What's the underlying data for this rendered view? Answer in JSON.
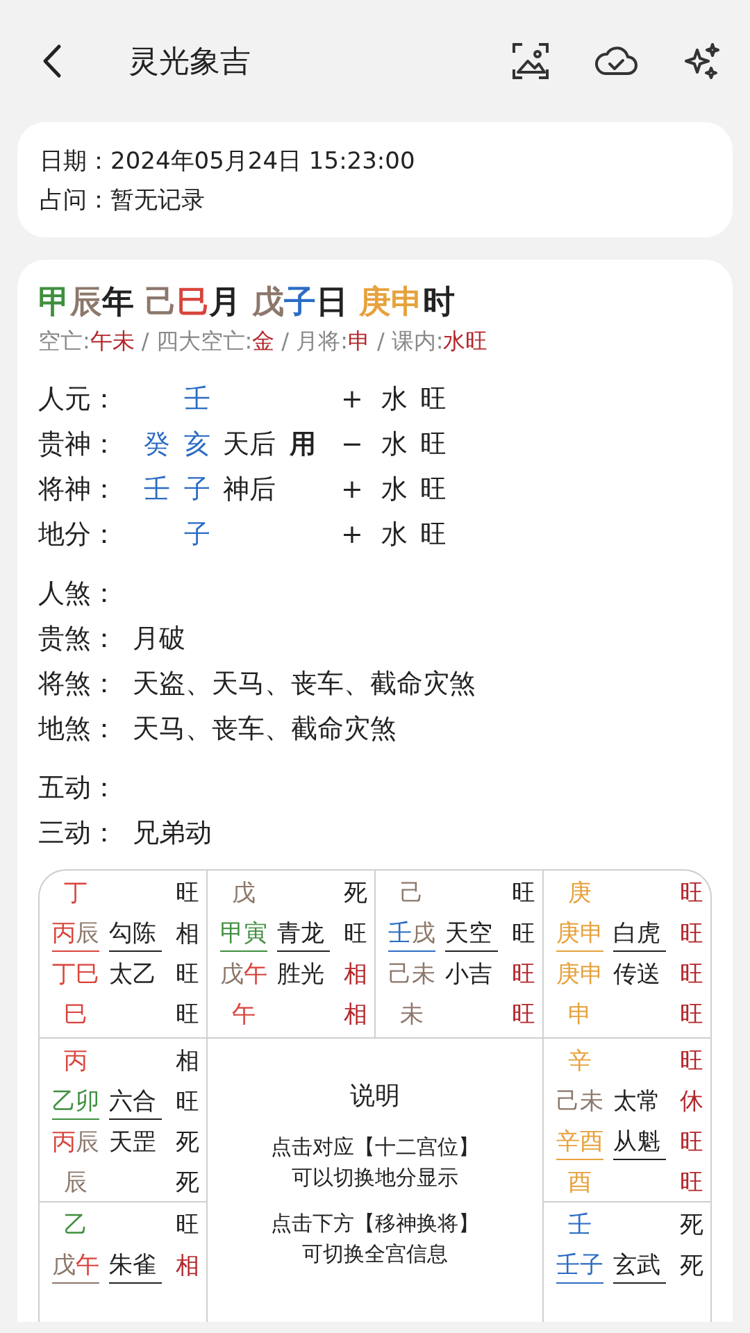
{
  "header": {
    "title": "灵光象吉"
  },
  "info": [
    {
      "label": "日期：",
      "value": "2024年05月24日 15:23:00"
    },
    {
      "label": "占问：",
      "value": "暂无记录"
    }
  ],
  "pillars": [
    {
      "chars": [
        {
          "t": "甲",
          "color": "#3f8f3f"
        },
        {
          "t": "辰",
          "color": "#8c776b"
        }
      ],
      "suffix": "年"
    },
    {
      "chars": [
        {
          "t": "己",
          "color": "#8c776b"
        },
        {
          "t": "巳",
          "color": "#d9443c"
        }
      ],
      "suffix": "月"
    },
    {
      "chars": [
        {
          "t": "戊",
          "color": "#8c776b"
        },
        {
          "t": "子",
          "color": "#2b6cc4"
        }
      ],
      "suffix": "日"
    },
    {
      "chars": [
        {
          "t": "庚",
          "color": "#e6a23c"
        },
        {
          "t": "申",
          "color": "#e6a23c"
        }
      ],
      "suffix": "时"
    }
  ],
  "kong_line": {
    "separator": "/",
    "items": [
      {
        "label": "空亡:",
        "value": "午未"
      },
      {
        "label": "四大空亡:",
        "value": "金"
      },
      {
        "label": "月将:",
        "value": "申"
      },
      {
        "label": "课内:",
        "value": "水旺"
      }
    ]
  },
  "positions": [
    {
      "label": "人元：",
      "char_2": "壬",
      "sign": "+",
      "element": "水",
      "state": "旺"
    },
    {
      "label": "贵神：",
      "char_1": "癸",
      "char_2": "亥",
      "god": "天后",
      "use": "用",
      "sign": "−",
      "element": "水",
      "state": "旺"
    },
    {
      "label": "将神：",
      "char_1": "壬",
      "char_2": "子",
      "god": "神后",
      "sign": "+",
      "element": "水",
      "state": "旺"
    },
    {
      "label": "地分：",
      "char_2": "子",
      "sign": "+",
      "element": "水",
      "state": "旺"
    }
  ],
  "shas": [
    {
      "label": "人煞："
    },
    {
      "label": "贵煞：",
      "value": "月破"
    },
    {
      "label": "将煞：",
      "value": "天盗、天马、丧车、截命灾煞"
    },
    {
      "label": "地煞：",
      "value": "天马、丧车、截命灾煞"
    }
  ],
  "dongs": [
    {
      "label": "五动："
    },
    {
      "label": "三动：",
      "value": "兄弟动"
    }
  ],
  "grid": {
    "top_row": [
      {
        "lines": [
          {
            "chars": [
              {
                "t": "丁",
                "color": "#d9443c"
              }
            ],
            "status": {
              "t": "旺",
              "color": "#222222"
            },
            "underlined": false
          },
          {
            "chars": [
              {
                "t": "丙",
                "color": "#d9443c"
              },
              {
                "t": "辰",
                "color": "#8c776b"
              }
            ],
            "god": "勾陈",
            "status": {
              "t": "相",
              "color": "#222222"
            },
            "underlined": true
          },
          {
            "chars": [
              {
                "t": "丁",
                "color": "#d9443c"
              },
              {
                "t": "巳",
                "color": "#d9443c"
              }
            ],
            "god": "太乙",
            "status": {
              "t": "旺",
              "color": "#222222"
            },
            "underlined": false
          },
          {
            "chars": [
              {
                "t": "巳",
                "color": "#d9443c"
              }
            ],
            "status": {
              "t": "旺",
              "color": "#222222"
            },
            "underlined": false
          }
        ]
      },
      {
        "lines": [
          {
            "chars": [
              {
                "t": "戊",
                "color": "#8c776b"
              }
            ],
            "status": {
              "t": "死",
              "color": "#222222"
            },
            "underlined": false
          },
          {
            "chars": [
              {
                "t": "甲",
                "color": "#3f8f3f"
              },
              {
                "t": "寅",
                "color": "#3f8f3f"
              }
            ],
            "god": "青龙",
            "status": {
              "t": "旺",
              "color": "#222222"
            },
            "underlined": true
          },
          {
            "chars": [
              {
                "t": "戊",
                "color": "#8c776b"
              },
              {
                "t": "午",
                "color": "#d9443c"
              }
            ],
            "god": "胜光",
            "status": {
              "t": "相",
              "color": "#b3262b"
            },
            "underlined": false
          },
          {
            "chars": [
              {
                "t": "午",
                "color": "#d9443c"
              }
            ],
            "status": {
              "t": "相",
              "color": "#b3262b"
            },
            "underlined": false
          }
        ]
      },
      {
        "lines": [
          {
            "chars": [
              {
                "t": "己",
                "color": "#8c776b"
              }
            ],
            "status": {
              "t": "旺",
              "color": "#222222"
            },
            "underlined": false
          },
          {
            "chars": [
              {
                "t": "壬",
                "color": "#2b6cc4"
              },
              {
                "t": "戌",
                "color": "#8c776b"
              }
            ],
            "god": "天空",
            "status": {
              "t": "旺",
              "color": "#222222"
            },
            "underlined": true
          },
          {
            "chars": [
              {
                "t": "己",
                "color": "#8c776b"
              },
              {
                "t": "未",
                "color": "#8c776b"
              }
            ],
            "god": "小吉",
            "status": {
              "t": "旺",
              "color": "#b3262b"
            },
            "underlined": false
          },
          {
            "chars": [
              {
                "t": "未",
                "color": "#8c776b"
              }
            ],
            "status": {
              "t": "旺",
              "color": "#b3262b"
            },
            "underlined": false
          }
        ]
      },
      {
        "lines": [
          {
            "chars": [
              {
                "t": "庚",
                "color": "#e6a23c"
              }
            ],
            "status": {
              "t": "旺",
              "color": "#b3262b"
            },
            "underlined": false
          },
          {
            "chars": [
              {
                "t": "庚",
                "color": "#e6a23c"
              },
              {
                "t": "申",
                "color": "#e6a23c"
              }
            ],
            "god": "白虎",
            "status": {
              "t": "旺",
              "color": "#b3262b"
            },
            "underlined": true
          },
          {
            "chars": [
              {
                "t": "庚",
                "color": "#e6a23c"
              },
              {
                "t": "申",
                "color": "#e6a23c"
              }
            ],
            "god": "传送",
            "status": {
              "t": "旺",
              "color": "#b3262b"
            },
            "underlined": false
          },
          {
            "chars": [
              {
                "t": "申",
                "color": "#e6a23c"
              }
            ],
            "status": {
              "t": "旺",
              "color": "#b3262b"
            },
            "underlined": false
          }
        ]
      }
    ],
    "left_column": [
      {
        "lines": [
          {
            "chars": [
              {
                "t": "丙",
                "color": "#d9443c"
              }
            ],
            "status": {
              "t": "相",
              "color": "#222222"
            },
            "underlined": false
          },
          {
            "chars": [
              {
                "t": "乙",
                "color": "#3f8f3f"
              },
              {
                "t": "卯",
                "color": "#3f8f3f"
              }
            ],
            "god": "六合",
            "status": {
              "t": "旺",
              "color": "#222222"
            },
            "underlined": true
          },
          {
            "chars": [
              {
                "t": "丙",
                "color": "#d9443c"
              },
              {
                "t": "辰",
                "color": "#8c776b"
              }
            ],
            "god": "天罡",
            "status": {
              "t": "死",
              "color": "#222222"
            },
            "underlined": false
          },
          {
            "chars": [
              {
                "t": "辰",
                "color": "#8c776b"
              }
            ],
            "status": {
              "t": "死",
              "color": "#222222"
            },
            "underlined": false
          }
        ]
      },
      {
        "lines": [
          {
            "chars": [
              {
                "t": "乙",
                "color": "#3f8f3f"
              }
            ],
            "status": {
              "t": "旺",
              "color": "#222222"
            },
            "underlined": false
          },
          {
            "chars": [
              {
                "t": "戊",
                "color": "#8c776b"
              },
              {
                "t": "午",
                "color": "#d9443c"
              }
            ],
            "god": "朱雀",
            "status": {
              "t": "相",
              "color": "#b3262b"
            },
            "underlined": true
          }
        ]
      }
    ],
    "center": {
      "title": "说明",
      "notes": [
        [
          "点击对应【十二宫位】",
          "可以切换地分显示"
        ],
        [
          "点击下方【移神换将】",
          "可切换全宫信息"
        ]
      ]
    },
    "right_column": [
      {
        "lines": [
          {
            "chars": [
              {
                "t": "辛",
                "color": "#e6a23c"
              }
            ],
            "status": {
              "t": "旺",
              "color": "#b3262b"
            },
            "underlined": false
          },
          {
            "chars": [
              {
                "t": "己",
                "color": "#8c776b"
              },
              {
                "t": "未",
                "color": "#8c776b"
              }
            ],
            "god": "太常",
            "status": {
              "t": "休",
              "color": "#b3262b"
            },
            "underlined": false
          },
          {
            "chars": [
              {
                "t": "辛",
                "color": "#e6a23c"
              },
              {
                "t": "酉",
                "color": "#e6a23c"
              }
            ],
            "god": "从魁",
            "status": {
              "t": "旺",
              "color": "#b3262b"
            },
            "underlined": true
          },
          {
            "chars": [
              {
                "t": "酉",
                "color": "#e6a23c"
              }
            ],
            "status": {
              "t": "旺",
              "color": "#b3262b"
            },
            "underlined": false
          }
        ]
      },
      {
        "lines": [
          {
            "chars": [
              {
                "t": "壬",
                "color": "#2b6cc4"
              }
            ],
            "status": {
              "t": "死",
              "color": "#222222"
            },
            "underlined": false
          },
          {
            "chars": [
              {
                "t": "壬",
                "color": "#2b6cc4"
              },
              {
                "t": "子",
                "color": "#2b6cc4"
              }
            ],
            "god": "玄武",
            "status": {
              "t": "死",
              "color": "#222222"
            },
            "underlined": true
          }
        ]
      }
    ]
  }
}
